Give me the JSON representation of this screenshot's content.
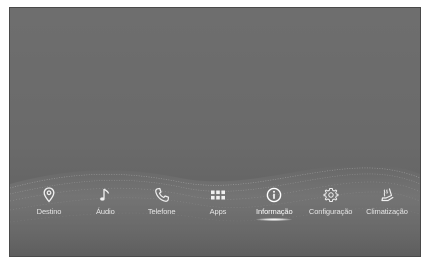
{
  "dock": {
    "items": [
      {
        "label": "Destino",
        "icon": "map-pin-icon",
        "active": false
      },
      {
        "label": "Áudio",
        "icon": "music-note-icon",
        "active": false
      },
      {
        "label": "Telefone",
        "icon": "phone-icon",
        "active": false
      },
      {
        "label": "Apps",
        "icon": "apps-grid-icon",
        "active": false
      },
      {
        "label": "Informação",
        "icon": "info-icon",
        "active": true
      },
      {
        "label": "Configuração",
        "icon": "gear-icon",
        "active": false
      },
      {
        "label": "Climatização",
        "icon": "seat-climate-icon",
        "active": false
      }
    ]
  },
  "colors": {
    "screen_background": "#6a6a6a",
    "label_text": "#e6e6e6",
    "icon": "#f0f0f0"
  }
}
